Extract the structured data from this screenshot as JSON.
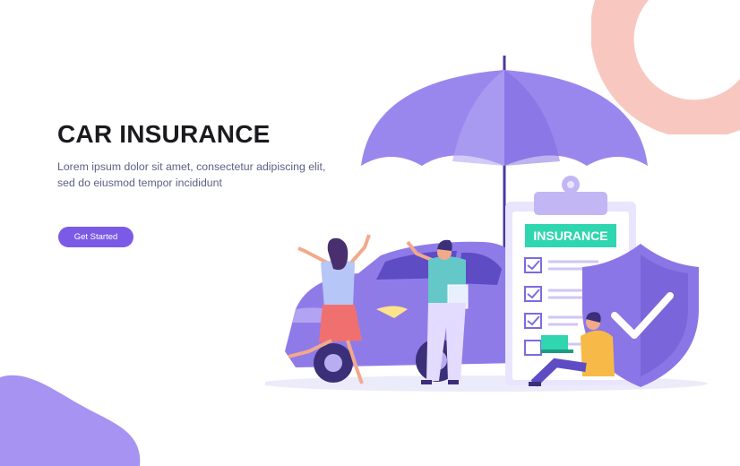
{
  "hero": {
    "title": "CAR INSURANCE",
    "description": "Lorem ipsum dolor sit amet, consectetur adipiscing elit, sed do eiusmod tempor incididunt",
    "cta_label": "Get Started"
  },
  "illustration": {
    "clipboard_label": "INSURANCE",
    "icons": [
      "umbrella-icon",
      "car-icon",
      "clipboard-icon",
      "shield-check-icon"
    ]
  },
  "colors": {
    "accent": "#7b5be6",
    "umbrella": "#9a87ee",
    "shield": "#8a76e6",
    "badge": "#2fd6b0",
    "deco_ring": "#f8c8c0",
    "deco_blob": "#a793f2"
  }
}
